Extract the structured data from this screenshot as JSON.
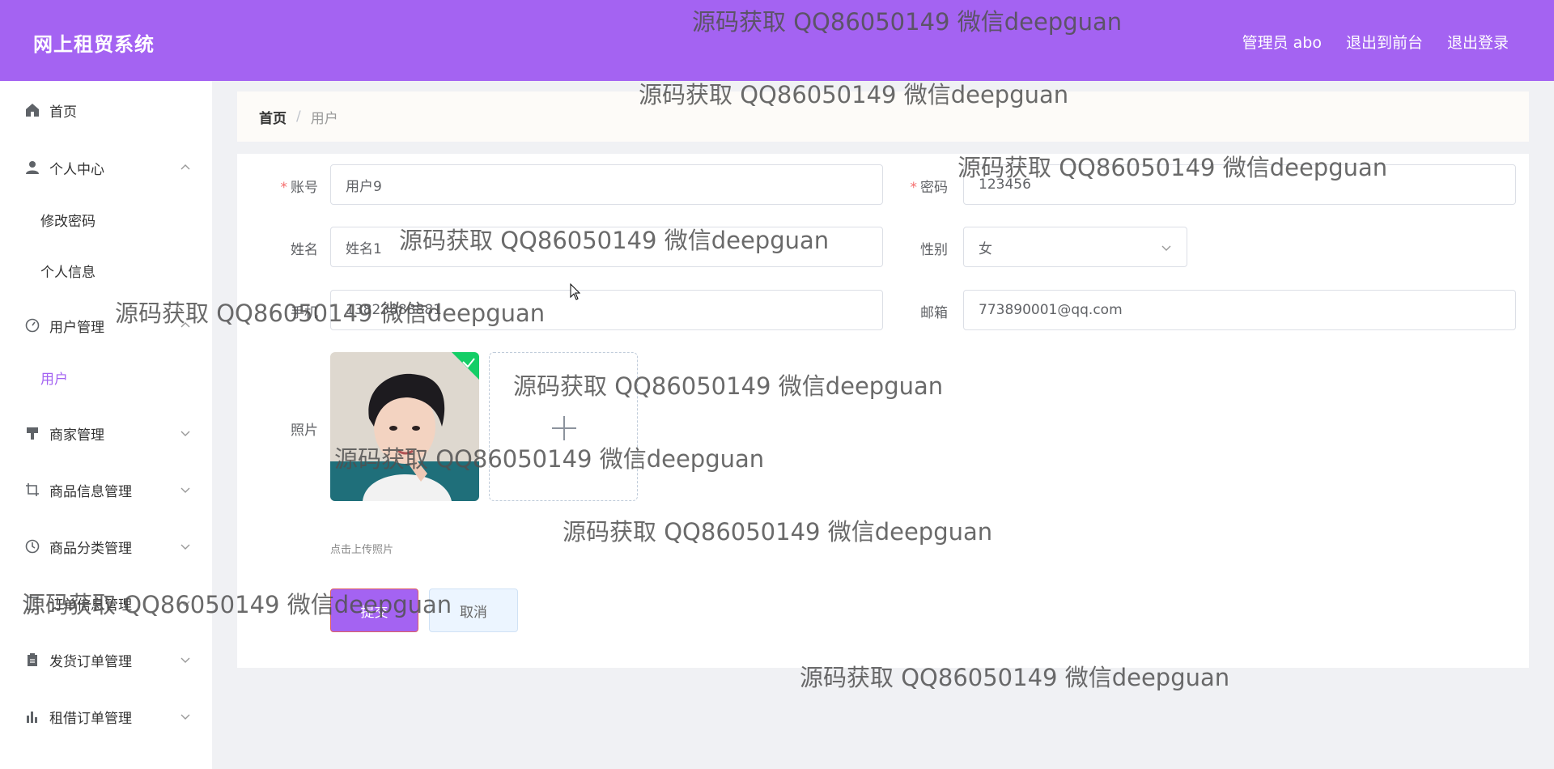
{
  "header": {
    "brand": "网上租贸系统",
    "admin_label": "管理员 abo",
    "exit_front_label": "退出到前台",
    "logout_label": "退出登录"
  },
  "sidebar": {
    "items": [
      {
        "label": "首页",
        "icon": "home-icon"
      },
      {
        "label": "个人中心",
        "icon": "user-icon",
        "expanded": true,
        "children": [
          {
            "label": "修改密码"
          },
          {
            "label": "个人信息"
          }
        ]
      },
      {
        "label": "用户管理",
        "icon": "dashboard-icon",
        "expanded": true,
        "children": [
          {
            "label": "用户",
            "active": true
          }
        ]
      },
      {
        "label": "商家管理",
        "icon": "shop-icon"
      },
      {
        "label": "商品信息管理",
        "icon": "crop-icon"
      },
      {
        "label": "商品分类管理",
        "icon": "clock-icon"
      },
      {
        "label": "订单信息管理",
        "icon": "order-icon"
      },
      {
        "label": "发货订单管理",
        "icon": "clipboard-icon"
      },
      {
        "label": "租借订单管理",
        "icon": "bar-chart-icon"
      }
    ]
  },
  "breadcrumb": {
    "home": "首页",
    "separator": "/",
    "current": "用户"
  },
  "form": {
    "account_label": "账号",
    "account_value": "用户9",
    "password_label": "密码",
    "password_value": "123456",
    "name_label": "姓名",
    "name_value": "姓名1",
    "gender_label": "性别",
    "gender_value": "女",
    "phone_label": "手机",
    "phone_value": "13823888881",
    "email_label": "邮箱",
    "email_value": "773890001@qq.com",
    "photo_label": "照片",
    "upload_hint": "点击上传照片",
    "submit_label": "提交",
    "cancel_label": "取消",
    "required_mark": "*",
    "upload_plus": "+"
  },
  "watermark": "源码获取 QQ86050149 微信deepguan",
  "colors": {
    "accent": "#a463f2",
    "required": "#f56c6c",
    "success": "#13ce66"
  }
}
